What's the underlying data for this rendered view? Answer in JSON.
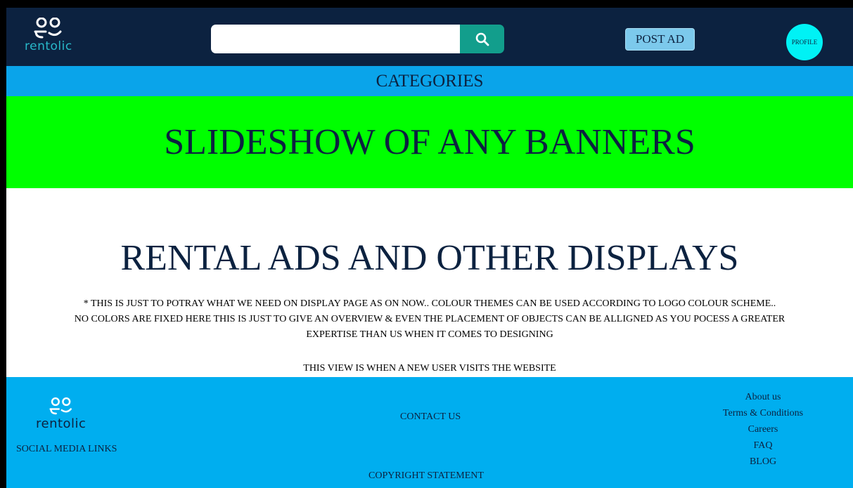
{
  "colors": {
    "header_bg": "#0c2240",
    "categories_bg": "#0aa4ea",
    "banner_bg": "#00ff00",
    "footer_bg": "#00aeef",
    "search_button": "#129e8c",
    "post_ad_bg": "#7cc9ec",
    "profile_bg": "#00f2f5",
    "logo_teal": "#28b8c9"
  },
  "header": {
    "logo": {
      "icon": "people-logo-icon",
      "text": "rentolic"
    },
    "search": {
      "value": "",
      "placeholder": "",
      "icon": "search-icon"
    },
    "post_ad_label": "POST AD",
    "profile_label": "PROFILE"
  },
  "categories": {
    "label": "CATEGORIES"
  },
  "banner": {
    "text": "SLIDESHOW OF ANY BANNERS"
  },
  "content": {
    "title": "RENTAL ADS AND OTHER DISPLAYS",
    "note_lines": [
      "* THIS IS JUST TO POTRAY WHAT WE NEED ON DISPLAY PAGE AS ON NOW.. COLOUR THEMES CAN BE USED ACCORDING TO LOGO COLOUR SCHEME..",
      "NO COLORS ARE FIXED HERE THIS IS JUST TO GIVE AN OVERVIEW & EVEN THE PLACEMENT OF OBJECTS CAN BE ALLIGNED AS YOU POCESS A GREATER",
      "EXPERTISE THAN US WHEN IT COMES TO DESIGNING"
    ],
    "view_note": "THIS VIEW IS WHEN A NEW USER VISITS THE WEBSITE"
  },
  "footer": {
    "logo": {
      "icon": "people-logo-icon",
      "text": "rentolic"
    },
    "social_label": "SOCIAL MEDIA LINKS",
    "contact_label": "CONTACT US",
    "links": [
      "About us",
      "Terms & Conditions",
      "Careers",
      "FAQ",
      "BLOG"
    ],
    "copyright": "COPYRIGHT STATEMENT"
  }
}
